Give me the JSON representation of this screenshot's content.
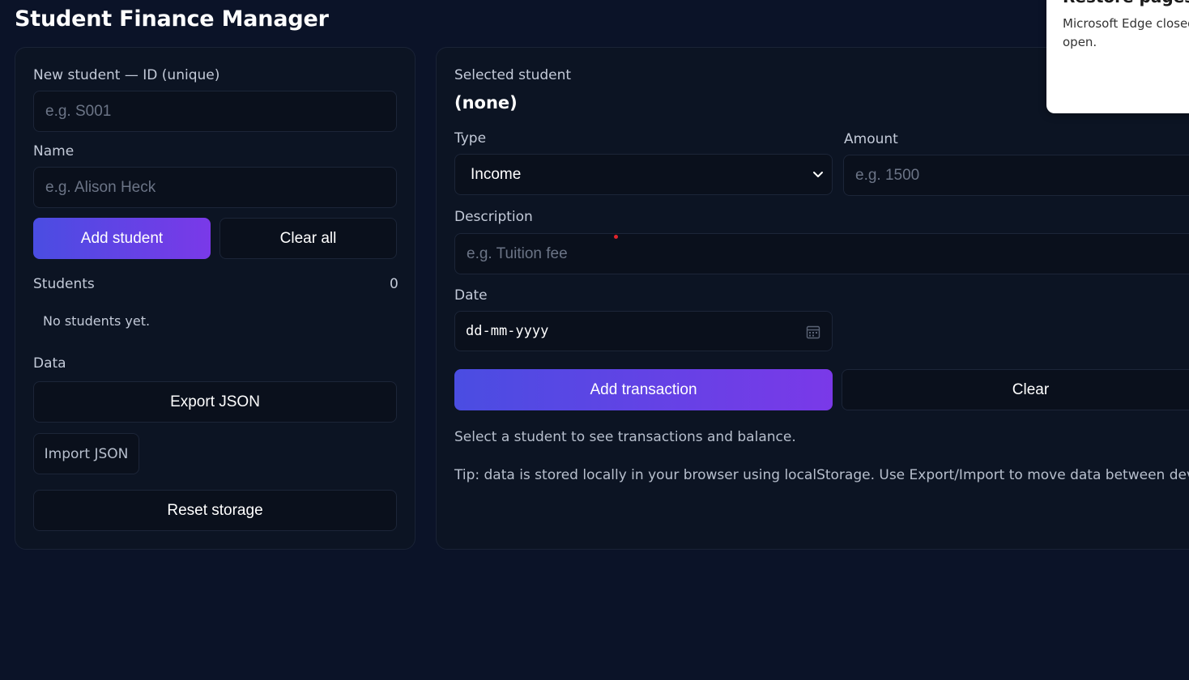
{
  "app": {
    "title": "Student Finance Manager"
  },
  "left_panel": {
    "id_label": "New student — ID (unique)",
    "id_placeholder": "e.g. S001",
    "name_label": "Name",
    "name_placeholder": "e.g. Alison Heck",
    "add_student_label": "Add student",
    "clear_all_label": "Clear all",
    "students_label": "Students",
    "students_count": "0",
    "empty_students": "No students yet.",
    "data_label": "Data",
    "export_label": "Export JSON",
    "import_label": "Import JSON",
    "reset_label": "Reset storage"
  },
  "right_panel": {
    "selected_label": "Selected student",
    "selected_value": "(none)",
    "type_label": "Type",
    "type_value": "Income",
    "amount_label": "Amount",
    "amount_placeholder": "e.g. 1500",
    "description_label": "Description",
    "description_placeholder": "e.g. Tuition fee",
    "date_label": "Date",
    "date_placeholder": "dd-mm-yyyy",
    "add_transaction_label": "Add transaction",
    "clear_label": "Clear",
    "select_hint": "Select a student to see transactions and balance.",
    "tip": "Tip: data is stored locally in your browser using localStorage. Use Export/Import to move data between devices."
  },
  "toast": {
    "title": "Restore pages",
    "message": "Microsoft Edge closed while you had some pages open."
  },
  "colors": {
    "background": "#0b1328",
    "panel": "#0c1423",
    "accent_start": "#4a4de2",
    "accent_end": "#7a39e8"
  }
}
